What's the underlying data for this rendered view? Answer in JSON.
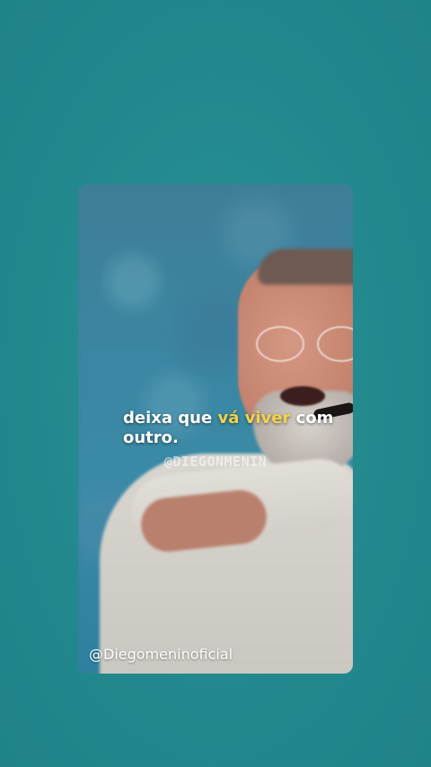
{
  "caption": {
    "part1": "deixa que ",
    "highlight": "vá viver",
    "part2": " com",
    "line2": "outro."
  },
  "watermark": "@DIEGONMENIN",
  "handle": "@Diegomeninoficial",
  "colors": {
    "background": "#238a8f",
    "highlight": "#f2d24a",
    "caption_text": "#ffffff"
  }
}
